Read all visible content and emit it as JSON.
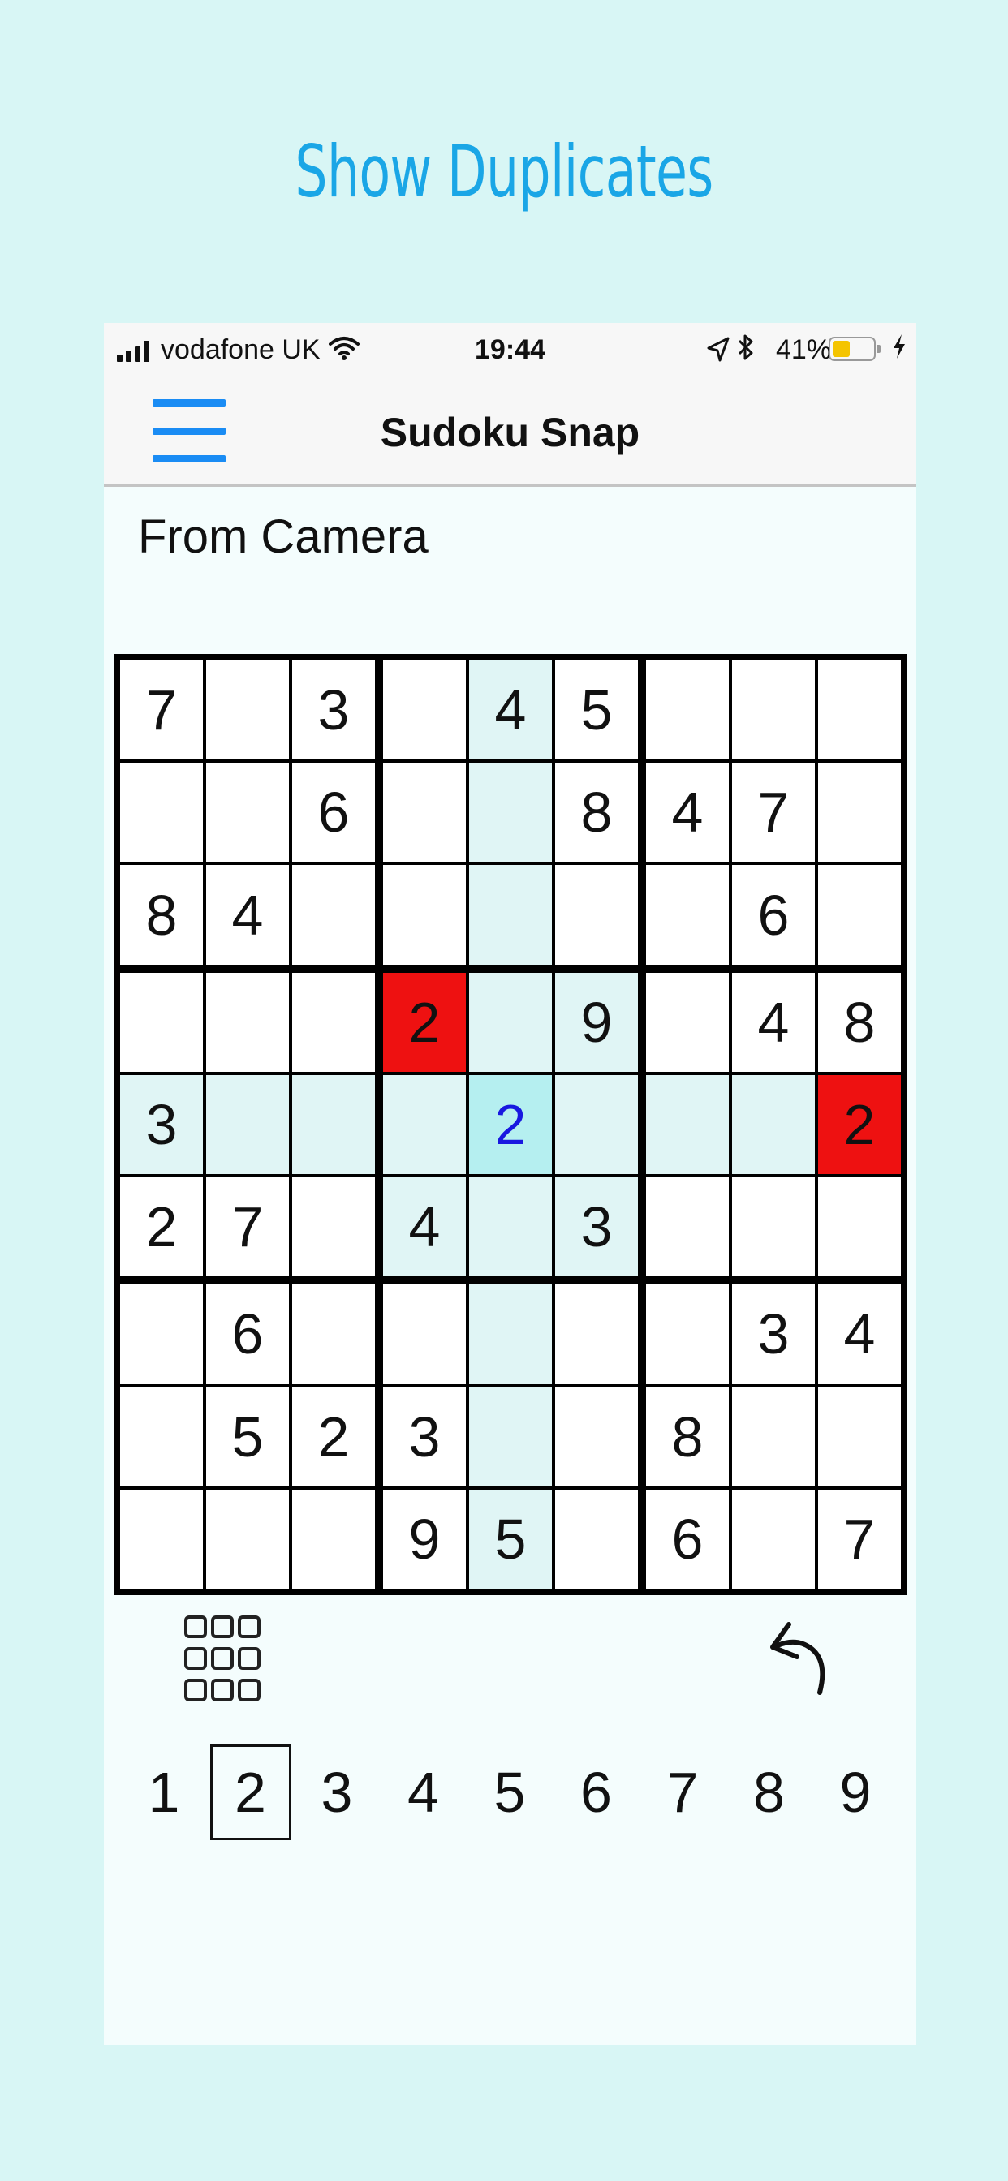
{
  "headline": "Show Duplicates",
  "status_bar": {
    "carrier": "vodafone UK",
    "time": "19:44",
    "battery_percent": "41%",
    "battery_level": 0.41
  },
  "nav": {
    "title": "Sudoku Snap",
    "menu_icon": "hamburger-menu-icon"
  },
  "source_label": "From Camera",
  "board": {
    "rows": [
      [
        "7",
        "",
        "3",
        "",
        "4",
        "5",
        "",
        "",
        ""
      ],
      [
        "",
        "",
        "6",
        "",
        "",
        "8",
        "4",
        "7",
        ""
      ],
      [
        "8",
        "4",
        "",
        "",
        "",
        "",
        "",
        "6",
        ""
      ],
      [
        "",
        "",
        "",
        "2",
        "",
        "9",
        "",
        "4",
        "8"
      ],
      [
        "3",
        "",
        "",
        "",
        "2",
        "",
        "",
        "",
        "2"
      ],
      [
        "2",
        "7",
        "",
        "4",
        "",
        "3",
        "",
        "",
        ""
      ],
      [
        "",
        "6",
        "",
        "",
        "",
        "",
        "",
        "3",
        "4"
      ],
      [
        "",
        "5",
        "2",
        "3",
        "",
        "",
        "8",
        "",
        ""
      ],
      [
        "",
        "",
        "",
        "9",
        "5",
        "",
        "6",
        "",
        "7"
      ]
    ],
    "selected_cell": [
      4,
      4
    ],
    "duplicate_cells": [
      [
        3,
        3
      ],
      [
        4,
        8
      ]
    ],
    "colors": {
      "highlight": "#e0f5f5",
      "selected": "#b5eff0",
      "selected_text": "#1818e0",
      "duplicate": "#ee1111"
    }
  },
  "toolbar": {
    "grid_icon": "grid-icon",
    "undo_icon": "undo-icon"
  },
  "numpad": {
    "keys": [
      "1",
      "2",
      "3",
      "4",
      "5",
      "6",
      "7",
      "8",
      "9"
    ],
    "active": "2"
  }
}
